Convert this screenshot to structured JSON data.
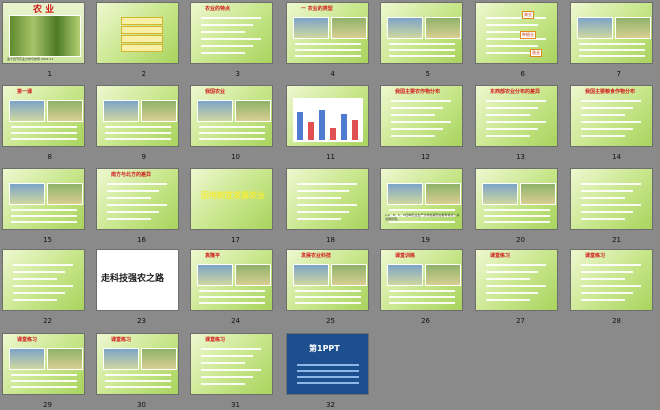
{
  "slides": [
    {
      "n": "1",
      "title": "农 业",
      "footer": "第十四节农业分布与布局 2024 01"
    },
    {
      "n": "2"
    },
    {
      "n": "3",
      "title": "农业的特点"
    },
    {
      "n": "4",
      "title": "一 农业的类型"
    },
    {
      "n": "5"
    },
    {
      "n": "6",
      "labels": [
        "林业",
        "种植业",
        "渔业"
      ]
    },
    {
      "n": "7"
    },
    {
      "n": "8",
      "title": "第一课"
    },
    {
      "n": "9"
    },
    {
      "n": "10",
      "title": "我国农业"
    },
    {
      "n": "11"
    },
    {
      "n": "12",
      "title": "我国主要农作物分布"
    },
    {
      "n": "13",
      "title": "东西部农业分布的差异"
    },
    {
      "n": "14",
      "title": "我国主要粮食作物分布"
    },
    {
      "n": "15"
    },
    {
      "n": "16",
      "title": "南方与北方的差异"
    },
    {
      "n": "17",
      "title": "因地制宜发展农业"
    },
    {
      "n": "18"
    },
    {
      "n": "19",
      "caption": "1.A、B、C、D四种农业生产分布和其形态各有特点？请说明原因。"
    },
    {
      "n": "20"
    },
    {
      "n": "21"
    },
    {
      "n": "22"
    },
    {
      "n": "23",
      "title": "走科技强农之路"
    },
    {
      "n": "24",
      "title": "袁隆平"
    },
    {
      "n": "25",
      "title": "发展农业科技"
    },
    {
      "n": "26",
      "title": "课堂训练"
    },
    {
      "n": "27",
      "title": "课堂练习"
    },
    {
      "n": "28",
      "title": "课堂练习"
    },
    {
      "n": "29",
      "title": "课堂练习"
    },
    {
      "n": "30",
      "title": "课堂练习"
    },
    {
      "n": "31",
      "title": "课堂练习"
    },
    {
      "n": "32",
      "title": "第1PPT"
    }
  ]
}
